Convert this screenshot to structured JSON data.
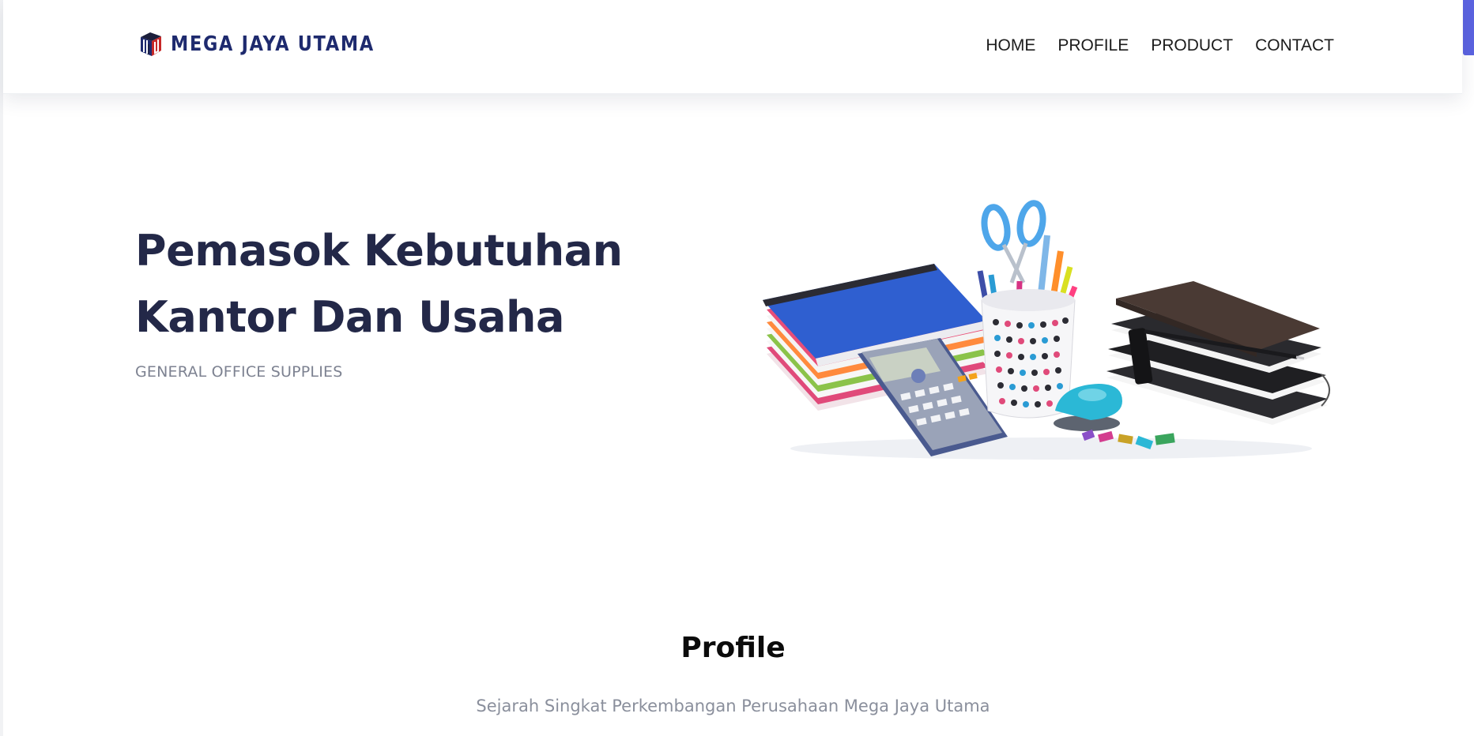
{
  "brand": {
    "name": "MEGA JAYA UTAMA",
    "logo_icon": "box-logo-icon",
    "primary_color": "#1e2a6e",
    "accent_color": "#d32f2f"
  },
  "nav": {
    "items": [
      {
        "label": "HOME"
      },
      {
        "label": "PROFILE"
      },
      {
        "label": "PRODUCT"
      },
      {
        "label": "CONTACT"
      }
    ]
  },
  "hero": {
    "title": "Pemasok Kebutuhan Kantor Dan Usaha",
    "subtitle": "GENERAL OFFICE SUPPLIES",
    "image_icon": "office-supplies-illustration"
  },
  "profile": {
    "title": "Profile",
    "subtitle": "Sejarah Singkat Perkembangan Perusahaan Mega Jaya Utama"
  }
}
